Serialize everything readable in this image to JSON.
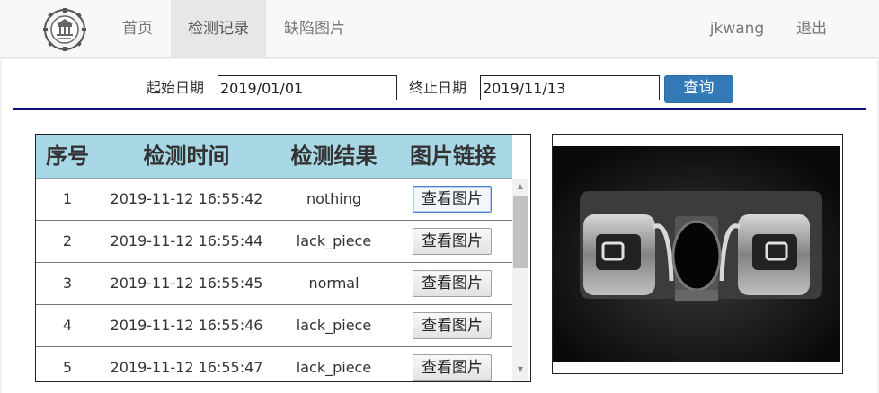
{
  "nav": {
    "items": [
      {
        "label": "首页",
        "active": false
      },
      {
        "label": "检测记录",
        "active": true
      },
      {
        "label": "缺陷图片",
        "active": false
      }
    ],
    "user": "jkwang",
    "logout": "退出"
  },
  "filter": {
    "start_label": "起始日期",
    "start_value": "2019/01/01",
    "end_label": "终止日期",
    "end_value": "2019/11/13",
    "query_label": "查询"
  },
  "table": {
    "headers": [
      "序号",
      "检测时间",
      "检测结果",
      "图片链接"
    ],
    "rows": [
      {
        "index": "1",
        "time": "2019-11-12 16:55:42",
        "result": "nothing",
        "link": "查看图片"
      },
      {
        "index": "2",
        "time": "2019-11-12 16:55:44",
        "result": "lack_piece",
        "link": "查看图片"
      },
      {
        "index": "3",
        "time": "2019-11-12 16:55:45",
        "result": "normal",
        "link": "查看图片"
      },
      {
        "index": "4",
        "time": "2019-11-12 16:55:46",
        "result": "lack_piece",
        "link": "查看图片"
      },
      {
        "index": "5",
        "time": "2019-11-12 16:55:47",
        "result": "lack_piece",
        "link": "查看图片"
      }
    ]
  },
  "icons": {
    "logo": "university-seal-logo",
    "scroll_up": "scroll-up-arrow-icon",
    "scroll_down": "scroll-down-arrow-icon"
  },
  "colors": {
    "header_bg": "#a8d8e6",
    "primary_button": "#337ab7",
    "divider": "#0f0f7a"
  }
}
